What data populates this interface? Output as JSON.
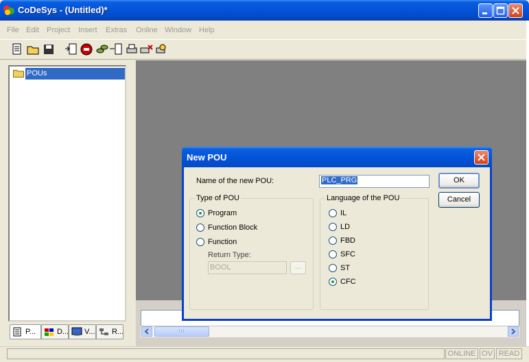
{
  "window": {
    "title": "CoDeSys - (Untitled)*"
  },
  "menu": [
    "File",
    "Edit",
    "Project",
    "Insert",
    "Extras",
    "Online",
    "Window",
    "Help"
  ],
  "tree": {
    "root_label": "POUs"
  },
  "tabs": [
    "P...",
    "D...",
    "V...",
    "R..."
  ],
  "status": {
    "online": "ONLINE",
    "ov": "OV",
    "read": "READ"
  },
  "dialog": {
    "title": "New POU",
    "name_label": "Name of the new POU:",
    "name_value": "PLC_PRG",
    "ok": "OK",
    "cancel": "Cancel",
    "type_group": "Type of POU",
    "types": [
      "Program",
      "Function Block",
      "Function"
    ],
    "selected_type": "Program",
    "return_type_label": "Return Type:",
    "return_type_value": "BOOL",
    "browse": "...",
    "language_group": "Language of the POU",
    "languages": [
      "IL",
      "LD",
      "FBD",
      "SFC",
      "ST",
      "CFC"
    ],
    "selected_language": "CFC"
  },
  "scrollbar": {
    "thumb_grip": "III"
  },
  "icons": {
    "app": "codesys-app-icon",
    "folder": "folder-icon",
    "minimize": "minimize-icon",
    "maximize": "maximize-icon",
    "close": "close-icon"
  },
  "colors": {
    "titlebar": "#0453d8",
    "selection": "#316ac5",
    "workspace": "#808080",
    "radio_dot": "#21a121"
  }
}
